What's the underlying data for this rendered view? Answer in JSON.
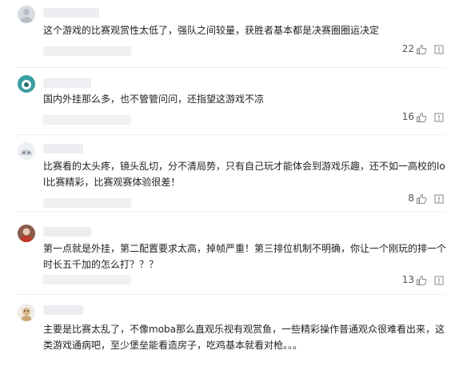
{
  "comments": [
    {
      "text": "这个游戏的比赛观赏性太低了，强队之间较量，获胜者基本都是决赛圈圈运决定",
      "likes": "22",
      "avatar_icon": "user-avatar-icon"
    },
    {
      "text": "国内外挂那么多，也不管管问问，还指望这游戏不凉",
      "likes": "16",
      "avatar_icon": "user-avatar-icon"
    },
    {
      "text": "比赛看的太头疼，镜头乱切，分不清局势，只有自己玩才能体会到游戏乐趣，还不如一高校的lol比赛精彩，比赛观赛体验很差！",
      "likes": "8",
      "avatar_icon": "user-avatar-icon"
    },
    {
      "text": "第一点就是外挂，第二配置要求太高，掉帧严重！第三排位机制不明确，你让一个刚玩的排一个时长五千加的怎么打？？？",
      "likes": "13",
      "avatar_icon": "user-avatar-icon"
    },
    {
      "text": "主要是比赛太乱了，不像moba那么直观乐视有观赏鱼，一些精彩操作普通观众很难看出来，这类游戏通病吧，至少堡垒能看造房子，吃鸡基本就看对枪。。。",
      "likes": "",
      "avatar_icon": "user-avatar-icon"
    }
  ]
}
